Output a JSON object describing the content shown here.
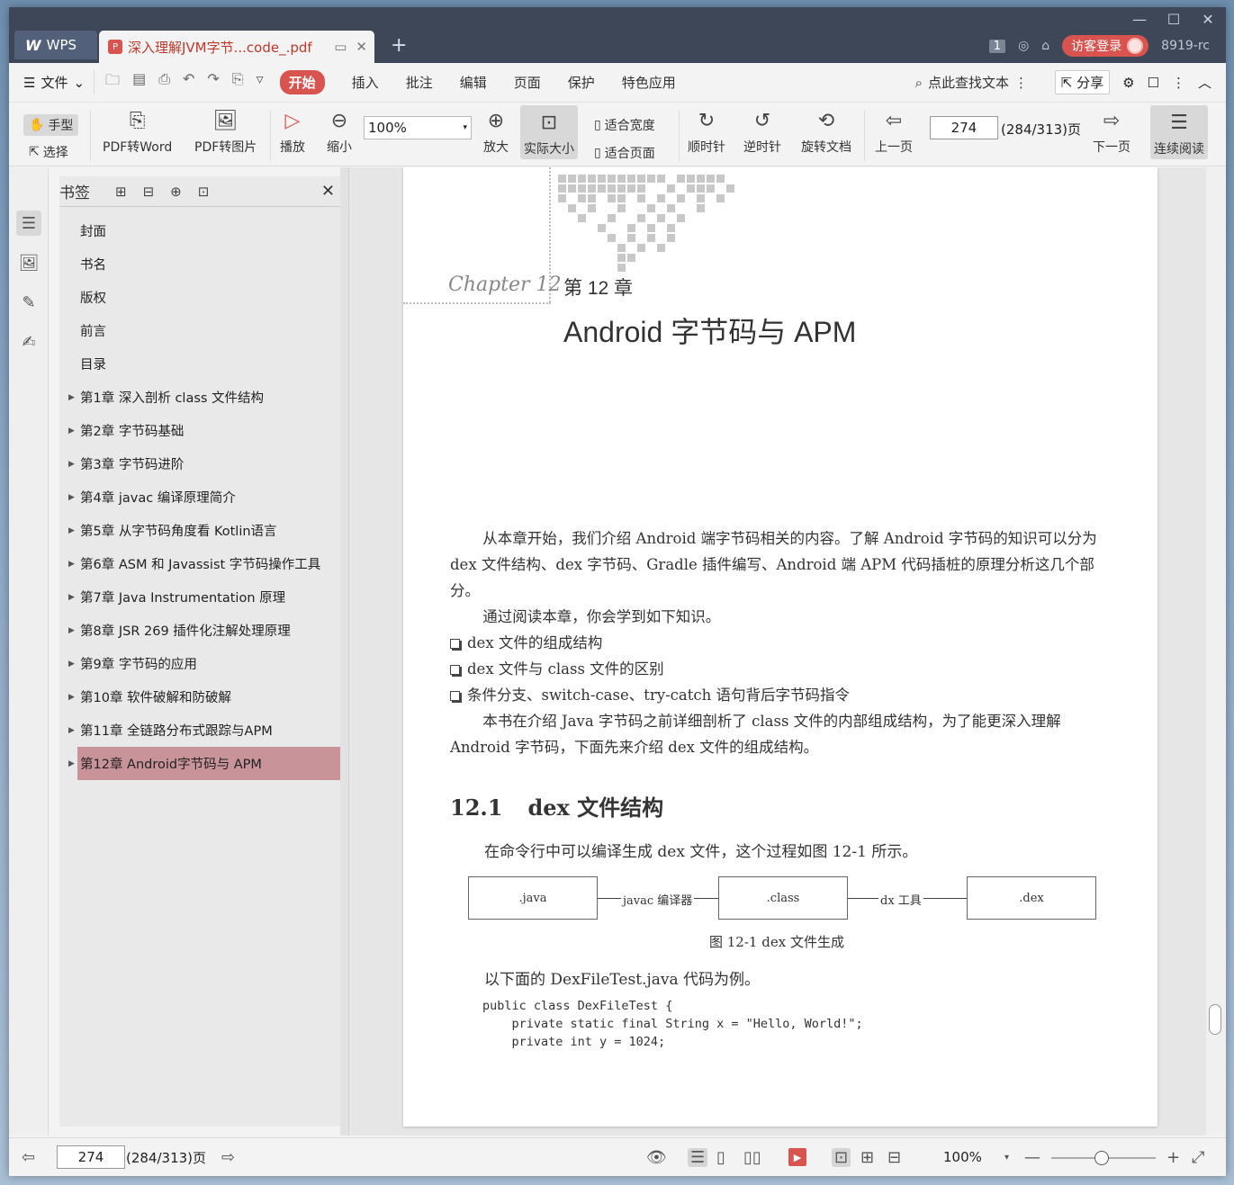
{
  "titlebar": {
    "app_tab": "WPS",
    "doc_tab": "深入理解JVM字节...code_.pdf",
    "badge_count": "1",
    "login_label": "访客登录",
    "user_id": "8919-rc"
  },
  "menu": {
    "file": "文件",
    "items": [
      "开始",
      "插入",
      "批注",
      "编辑",
      "页面",
      "保护",
      "特色应用"
    ],
    "search": "点此查找文本",
    "share": "分享"
  },
  "toolbar": {
    "hand": "手型",
    "select": "选择",
    "pdf2word": "PDF转Word",
    "pdf2img": "PDF转图片",
    "play": "播放",
    "zoom_out": "缩小",
    "zoom_value": "100%",
    "zoom_in": "放大",
    "actual_size": "实际大小",
    "fit_width": "适合宽度",
    "fit_page": "适合页面",
    "cw": "顺时针",
    "ccw": "逆时针",
    "rotate_doc": "旋转文档",
    "prev_page": "上一页",
    "page_input": "274",
    "page_total": "(284/313)页",
    "next_page": "下一页",
    "continuous": "连续阅读"
  },
  "bookmarks": {
    "title": "书签",
    "items": [
      {
        "label": "封面",
        "expandable": false
      },
      {
        "label": "书名",
        "expandable": false
      },
      {
        "label": "版权",
        "expandable": false
      },
      {
        "label": "前言",
        "expandable": false
      },
      {
        "label": "目录",
        "expandable": false
      },
      {
        "label": "第1章 深入剖析 class 文件结构",
        "expandable": true
      },
      {
        "label": "第2章 字节码基础",
        "expandable": true
      },
      {
        "label": "第3章 字节码进阶",
        "expandable": true
      },
      {
        "label": "第4章 javac 编译原理简介",
        "expandable": true
      },
      {
        "label": "第5章 从字节码角度看 Kotlin语言",
        "expandable": true
      },
      {
        "label": "第6章 ASM 和 Javassist 字节码操作工具",
        "expandable": true
      },
      {
        "label": "第7章 Java Instrumentation 原理",
        "expandable": true
      },
      {
        "label": "第8章 JSR 269 插件化注解处理原理",
        "expandable": true
      },
      {
        "label": "第9章 字节码的应用",
        "expandable": true
      },
      {
        "label": "第10章 软件破解和防破解",
        "expandable": true
      },
      {
        "label": "第11章 全链路分布式跟踪与APM",
        "expandable": true
      },
      {
        "label": "第12章 Android字节码与 APM",
        "expandable": true,
        "selected": true
      }
    ]
  },
  "page": {
    "chapter_script": "Chapter 12",
    "chapter_num": "第 12 章",
    "chapter_title": "Android 字节码与 APM",
    "para1": "从本章开始，我们介绍 Android 端字节码相关的内容。了解 Android 字节码的知识可以分为 dex 文件结构、dex 字节码、Gradle 插件编写、Android 端 APM 代码插桩的原理分析这几个部分。",
    "para2": "通过阅读本章，你会学到如下知识。",
    "bullets": [
      "dex 文件的组成结构",
      "dex 文件与 class 文件的区别",
      "条件分支、switch-case、try-catch 语句背后字节码指令"
    ],
    "para3": "本书在介绍 Java 字节码之前详细剖析了 class 文件的内部组成结构，为了能更深入理解 Android 字节码，下面先来介绍 dex 文件的组成结构。",
    "section_num": "12.1",
    "section_title": "dex 文件结构",
    "para4": "在命令行中可以编译生成 dex 文件，这个过程如图 12-1 所示。",
    "figure": {
      "box1": ".java",
      "arrow1": "javac 编译器",
      "box2": ".class",
      "arrow2": "dx 工具",
      "box3": ".dex",
      "caption": "图 12-1    dex 文件生成"
    },
    "para5": "以下面的 DexFileTest.java 代码为例。",
    "code": "public class DexFileTest {\n    private static final String x = \"Hello, World!\";\n    private int y = 1024;"
  },
  "statusbar": {
    "page_input": "274",
    "page_total": "(284/313)页",
    "zoom": "100%"
  }
}
